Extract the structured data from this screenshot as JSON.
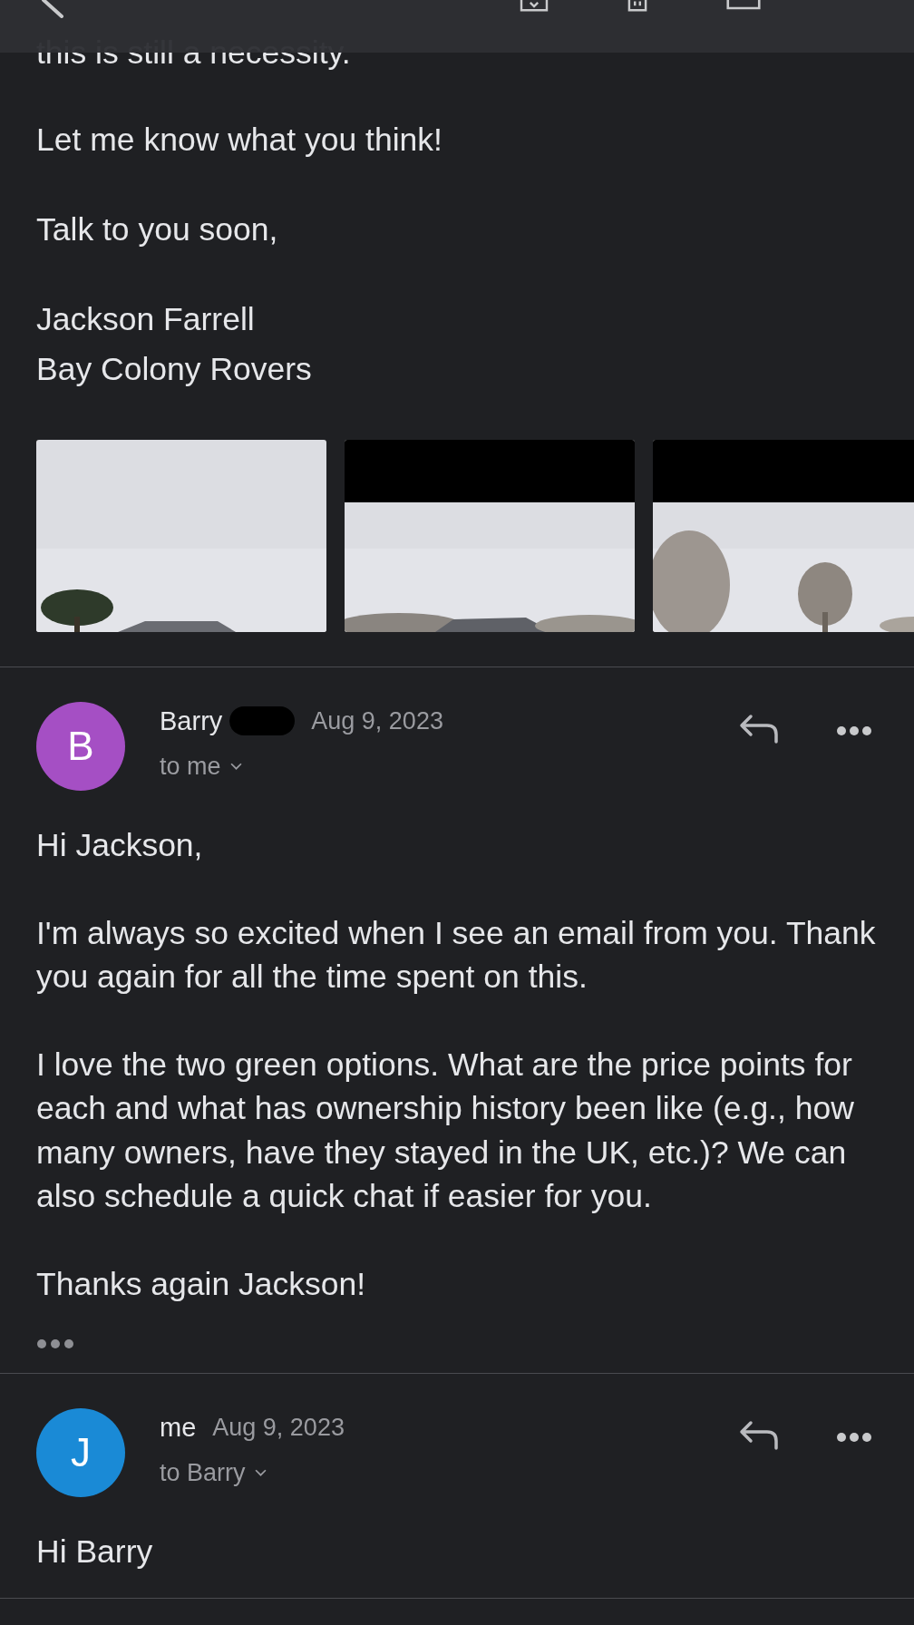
{
  "top_message": {
    "body": [
      "this is still a necessity.",
      "Let me know what you think!",
      "Talk to you soon,"
    ],
    "signature": [
      "Jackson Farrell",
      "Bay Colony Rovers"
    ],
    "attachments": [
      {
        "kind": "picture",
        "letterbox": false
      },
      {
        "kind": "picture",
        "letterbox": true
      },
      {
        "kind": "picture",
        "letterbox": true
      }
    ]
  },
  "messages": [
    {
      "avatar_letter": "B",
      "color": "#a54fc4",
      "sender": "Barry",
      "redacted": true,
      "date": "Aug 9, 2023",
      "recipients": "to me",
      "body": [
        "Hi Jackson,",
        "I'm always so excited when I see an email from you. Thank you again for all the time spent on this.",
        "I love the two green options. What are the price points for each and what has ownership history been like (e.g., how many owners, have they stayed in the UK, etc.)? We can also schedule a quick chat if easier for you.",
        "Thanks again Jackson!"
      ],
      "collapsed_quote": true
    },
    {
      "avatar_letter": "J",
      "color": "#1a8ad6",
      "sender": "me",
      "redacted": false,
      "date": "Aug 9, 2023",
      "recipients": "to Barry",
      "body": [
        "Hi Barry"
      ],
      "collapsed_quote": false
    }
  ]
}
